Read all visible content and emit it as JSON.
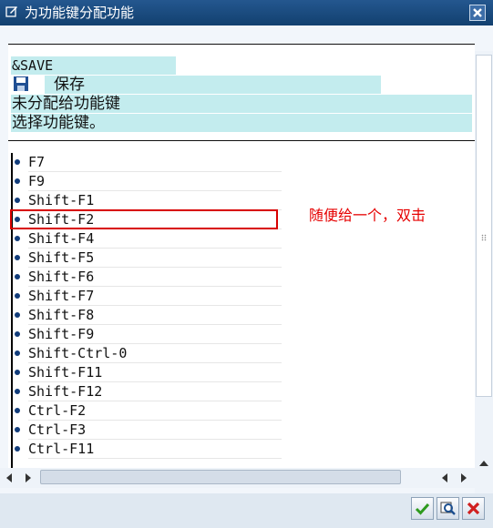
{
  "window": {
    "title": "为功能键分配功能"
  },
  "command": {
    "code": "&SAVE",
    "text": "保存"
  },
  "info": {
    "line1": "未分配给功能键",
    "line2": "选择功能键。"
  },
  "keys": [
    "F7",
    "F9",
    "Shift-F1",
    "Shift-F2",
    "Shift-F4",
    "Shift-F5",
    "Shift-F6",
    "Shift-F7",
    "Shift-F8",
    "Shift-F9",
    "Shift-Ctrl-0",
    "Shift-F11",
    "Shift-F12",
    "Ctrl-F2",
    "Ctrl-F3",
    "Ctrl-F11"
  ],
  "annotation": "随便给一个，双击",
  "colors": {
    "titlebar": "#12406f",
    "highlight": "#c3ecee",
    "annotation": "#e60000",
    "ok": "#2e9a1e",
    "cancel": "#d02020"
  },
  "icons": [
    "edit-window-icon",
    "close-icon",
    "save-icon",
    "bullet-icon",
    "scroll-up-icon",
    "scroll-down-icon",
    "scroll-left-icon",
    "scroll-right-icon",
    "ok-check-icon",
    "find-icon",
    "cancel-icon"
  ]
}
